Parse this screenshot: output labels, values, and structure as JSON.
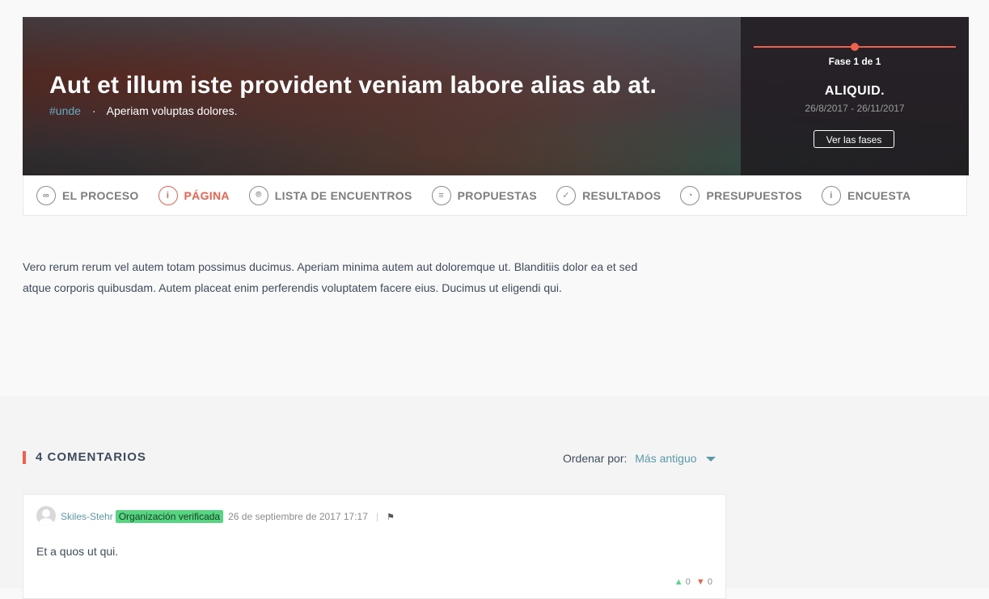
{
  "hero": {
    "title": "Aut et illum iste provident veniam labore alias ab at.",
    "hashtag": "#unde",
    "dot": "·",
    "subtitle": "Aperiam voluptas dolores."
  },
  "phase": {
    "step": "Fase 1 de 1",
    "name": "ALIQUID.",
    "dates": "26/8/2017 - 26/11/2017",
    "button_label": "Ver las fases",
    "progress": 0.5
  },
  "tabs": [
    {
      "label": "EL PROCESO",
      "icon": "process-icon",
      "glyph": "∞",
      "active": false
    },
    {
      "label": "PÁGINA",
      "icon": "info-icon",
      "glyph": "i",
      "active": true
    },
    {
      "label": "LISTA DE ENCUENTROS",
      "icon": "map-pin-icon",
      "glyph": "⌾",
      "active": false
    },
    {
      "label": "PROPUESTAS",
      "icon": "proposals-icon",
      "glyph": "≡",
      "active": false
    },
    {
      "label": "RESULTADOS",
      "icon": "check-icon",
      "glyph": "✓",
      "active": false
    },
    {
      "label": "PRESUPUESTOS",
      "icon": "pie-chart-icon",
      "glyph": "◔",
      "active": false
    },
    {
      "label": "ENCUESTA",
      "icon": "info-icon",
      "glyph": "i",
      "active": false
    }
  ],
  "content": {
    "body": "Vero rerum rerum vel autem totam possimus ducimus. Aperiam minima autem aut doloremque ut. Blanditiis dolor ea et sed atque corporis quibusdam. Autem placeat enim perferendis voluptatem facere eius. Ducimus ut eligendi qui."
  },
  "comments": {
    "title": "4 COMENTARIOS",
    "order_label": "Ordenar por:",
    "order_value": "Más antiguo",
    "items": [
      {
        "author": "Skiles-Stehr",
        "badge": "Organización verificada",
        "date": "26 de septiembre de 2017 17:17",
        "separator": "|",
        "body": "Et a quos ut qui.",
        "up_votes": "0",
        "down_votes": "0"
      }
    ]
  },
  "colors": {
    "accent": "#ef604d",
    "link": "#599aa6",
    "badge": "#57d681"
  }
}
